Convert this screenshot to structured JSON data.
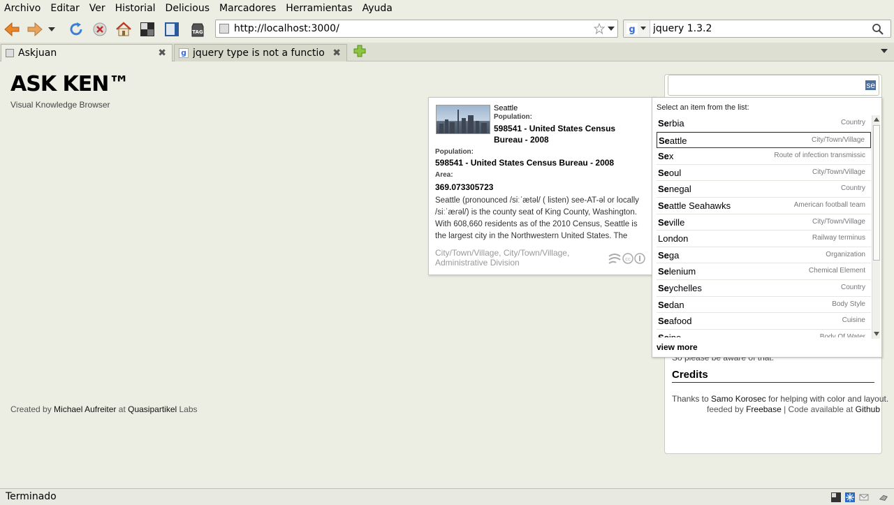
{
  "menu": [
    "Archivo",
    "Editar",
    "Ver",
    "Historial",
    "Delicious",
    "Marcadores",
    "Herramientas",
    "Ayuda"
  ],
  "nav": {
    "url": "http://localhost:3000/",
    "search_value": "jquery 1.3.2"
  },
  "tabs": [
    {
      "label": "Askjuan"
    },
    {
      "label": "jquery type is not a functio..."
    }
  ],
  "page": {
    "logo": "ASK KEN™",
    "subtitle": "Visual Knowledge Browser",
    "search_selected_text": "se",
    "credits_title": "Credits",
    "credits_text_prefix": "Thanks to",
    "credits_link": "Samo Korosec",
    "credits_text_suffix": "for helping with color and layout.",
    "aware_text": "So please be aware of that."
  },
  "card": {
    "name": "Seattle",
    "pop_label": "Population:",
    "pop_value": "598541 - United States Census Bureau - 2008",
    "pop_label2": "Population:",
    "pop_value2": "598541 - United States Census Bureau - 2008",
    "area_label": "Area:",
    "area_value": "369.073305723",
    "description": "Seattle (pronounced /siːˈætəl/ ( listen) see-AT-əl or locally /siːˈæɾəl/) is the county seat of King County, Washington. With 608,660 residents as of the 2010 Census, Seattle is the largest city in the Northwestern United States. The Seattle...",
    "types": "City/Town/Village, City/Town/Village, Administrative Division"
  },
  "suggest": {
    "header": "Select an item from the list:",
    "items": [
      {
        "prefix": "Se",
        "rest": "rbia",
        "type": "Country"
      },
      {
        "prefix": "Se",
        "rest": "attle",
        "type": "City/Town/Village"
      },
      {
        "prefix": "Se",
        "rest": "x",
        "type": "Route of infection transmissic"
      },
      {
        "prefix": "Se",
        "rest": "oul",
        "type": "City/Town/Village"
      },
      {
        "prefix": "Se",
        "rest": "negal",
        "type": "Country"
      },
      {
        "prefix": "Se",
        "rest": "attle Seahawks",
        "type": "American football team"
      },
      {
        "prefix": "Se",
        "rest": "ville",
        "type": "City/Town/Village"
      },
      {
        "prefix": "",
        "rest": "London",
        "type": "Railway terminus"
      },
      {
        "prefix": "Se",
        "rest": "ga",
        "type": "Organization"
      },
      {
        "prefix": "Se",
        "rest": "lenium",
        "type": "Chemical Element"
      },
      {
        "prefix": "Se",
        "rest": "ychelles",
        "type": "Country"
      },
      {
        "prefix": "Se",
        "rest": "dan",
        "type": "Body Style"
      },
      {
        "prefix": "Se",
        "rest": "afood",
        "type": "Cuisine"
      },
      {
        "prefix": "Se",
        "rest": "ine",
        "type": "Body Of Water"
      }
    ],
    "view_more": "view more"
  },
  "footer": {
    "created_by": "Created by",
    "author": "Michael Aufreiter",
    "at": "at",
    "org": "Quasipartikel",
    "labs": "Labs",
    "feeded_by": "feeded by",
    "freebase": "Freebase",
    "code_available": "| Code available at",
    "github": "Github"
  },
  "status": {
    "text": "Terminado"
  },
  "colors": {
    "background": "#eceee3",
    "selection": "#4a6e9e"
  }
}
